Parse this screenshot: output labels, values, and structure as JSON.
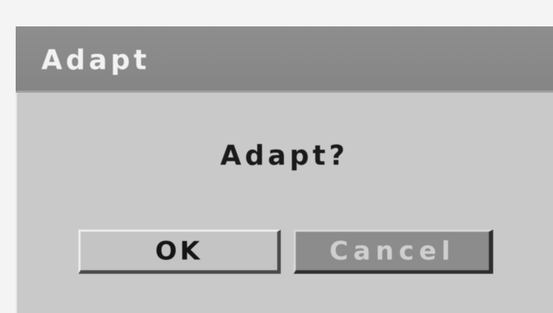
{
  "dialog": {
    "title": "Adapt",
    "message": "Adapt?",
    "buttons": {
      "ok_label": "OK",
      "cancel_label": "Cancel"
    }
  },
  "colors": {
    "title_bar": "#8a8a8a",
    "dialog_body": "#c9c9c9",
    "ok_button": "#c4c4c4",
    "cancel_button": "#8c8c8c"
  }
}
